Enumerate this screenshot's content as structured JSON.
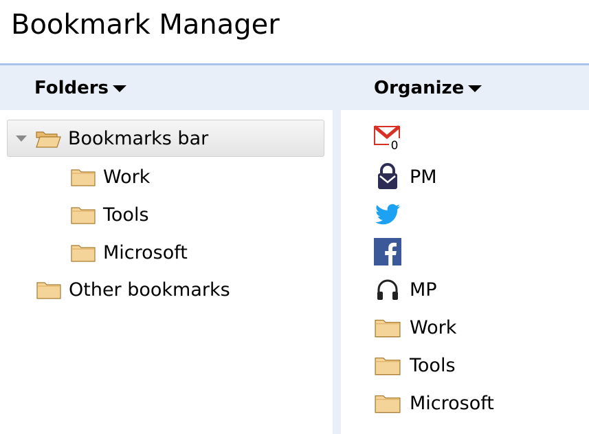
{
  "app": {
    "title": "Bookmark Manager"
  },
  "toolbar": {
    "folders_label": "Folders",
    "organize_label": "Organize"
  },
  "tree": {
    "root": {
      "label": "Bookmarks bar",
      "expanded": true,
      "selected": true
    },
    "children": [
      {
        "label": "Work"
      },
      {
        "label": "Tools"
      },
      {
        "label": "Microsoft"
      }
    ],
    "other": {
      "label": "Other bookmarks"
    }
  },
  "list": {
    "items": [
      {
        "icon": "gmail-icon",
        "label": "",
        "badge": "0"
      },
      {
        "icon": "protonmail-icon",
        "label": "PM"
      },
      {
        "icon": "twitter-icon",
        "label": ""
      },
      {
        "icon": "facebook-icon",
        "label": ""
      },
      {
        "icon": "headphones-icon",
        "label": "MP"
      },
      {
        "icon": "folder-icon",
        "label": "Work"
      },
      {
        "icon": "folder-icon",
        "label": "Tools"
      },
      {
        "icon": "folder-icon",
        "label": "Microsoft"
      }
    ]
  },
  "colors": {
    "header_bg": "#e9eff9",
    "header_border": "#a9c4ea",
    "folder_fill": "#f5d49a",
    "twitter_blue": "#1da1f2",
    "facebook_blue": "#3b5998",
    "gmail_red": "#d93025",
    "protonmail_purple": "#2c2c54"
  }
}
